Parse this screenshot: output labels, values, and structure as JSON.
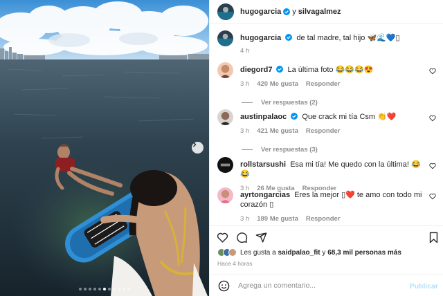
{
  "post": {
    "author": "hugogarcia",
    "connector": "y",
    "collaborator": "silvagalmez",
    "caption_user": "hugogarcia",
    "caption_text": "de tal madre, tal hijo 🦋🌊💙▯",
    "caption_time": "4 h"
  },
  "comments": [
    {
      "user": "diegord7",
      "verified": true,
      "text": "La última foto 😂😂😂😍",
      "time": "3 h",
      "likes": "420 Me gusta",
      "reply_label": "Responder",
      "view_replies": "Ver respuestas (2)"
    },
    {
      "user": "austinpalaoc",
      "verified": true,
      "text": "Que crack mi tía Csm 👏❤️",
      "time": "3 h",
      "likes": "421 Me gusta",
      "reply_label": "Responder",
      "view_replies": "Ver respuestas (3)"
    },
    {
      "user": "rollstarsushi",
      "verified": false,
      "text": "Esa mi tía! Me quedo con la última! 😂😂",
      "time": "3 h",
      "likes": "26 Me gusta",
      "reply_label": "Responder",
      "view_replies": ""
    },
    {
      "user": "ayrtongarcias",
      "verified": false,
      "text": "Eres la mejor ▯❤️ te amo con todo mi corazón ▯",
      "time": "3 h",
      "likes": "189 Me gusta",
      "reply_label": "Responder",
      "view_replies": ""
    }
  ],
  "likes": {
    "prefix": "Les gusta a",
    "user": "saidpalao_fit",
    "middle": "y",
    "others": "68,3 mil personas más"
  },
  "time_ago": "Hace 4 horas",
  "add_comment": {
    "placeholder": "Agrega un comentario...",
    "publish_label": "Publicar"
  },
  "carousel": {
    "total_slides": 11,
    "active_index": 5
  },
  "colors": {
    "verified": "#0095f6",
    "publish_disabled": "#b2dffc",
    "meta_gray": "#8e8e8e",
    "heart_red": "#ed4956"
  },
  "icons": [
    "verified-icon",
    "heart-icon",
    "comment-icon",
    "share-icon",
    "bookmark-icon",
    "emoji-icon",
    "chevron-right-icon"
  ]
}
